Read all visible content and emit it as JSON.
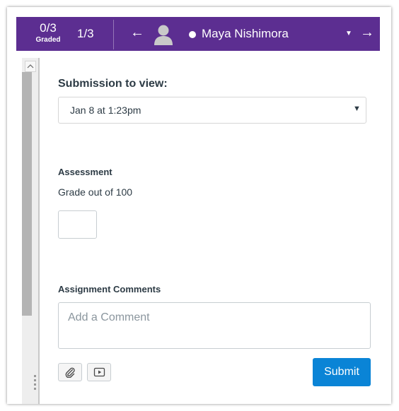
{
  "header": {
    "graded_count": "0/3",
    "graded_label": "Graded",
    "student_position": "1/3",
    "prev_arrow": "←",
    "next_arrow": "→",
    "student_name": "Maya Nishimora",
    "dropdown_caret": "▼",
    "background_color": "#5c2e91"
  },
  "submission": {
    "title": "Submission to view:",
    "selected": "Jan 8 at 1:23pm"
  },
  "assessment": {
    "title": "Assessment",
    "grade_label": "Grade out of 100",
    "grade_value": ""
  },
  "comments": {
    "title": "Assignment Comments",
    "placeholder": "Add a Comment",
    "attach_icon": "paperclip-icon",
    "media_icon": "media-icon"
  },
  "actions": {
    "submit_label": "Submit",
    "submit_color": "#0a84d6"
  }
}
